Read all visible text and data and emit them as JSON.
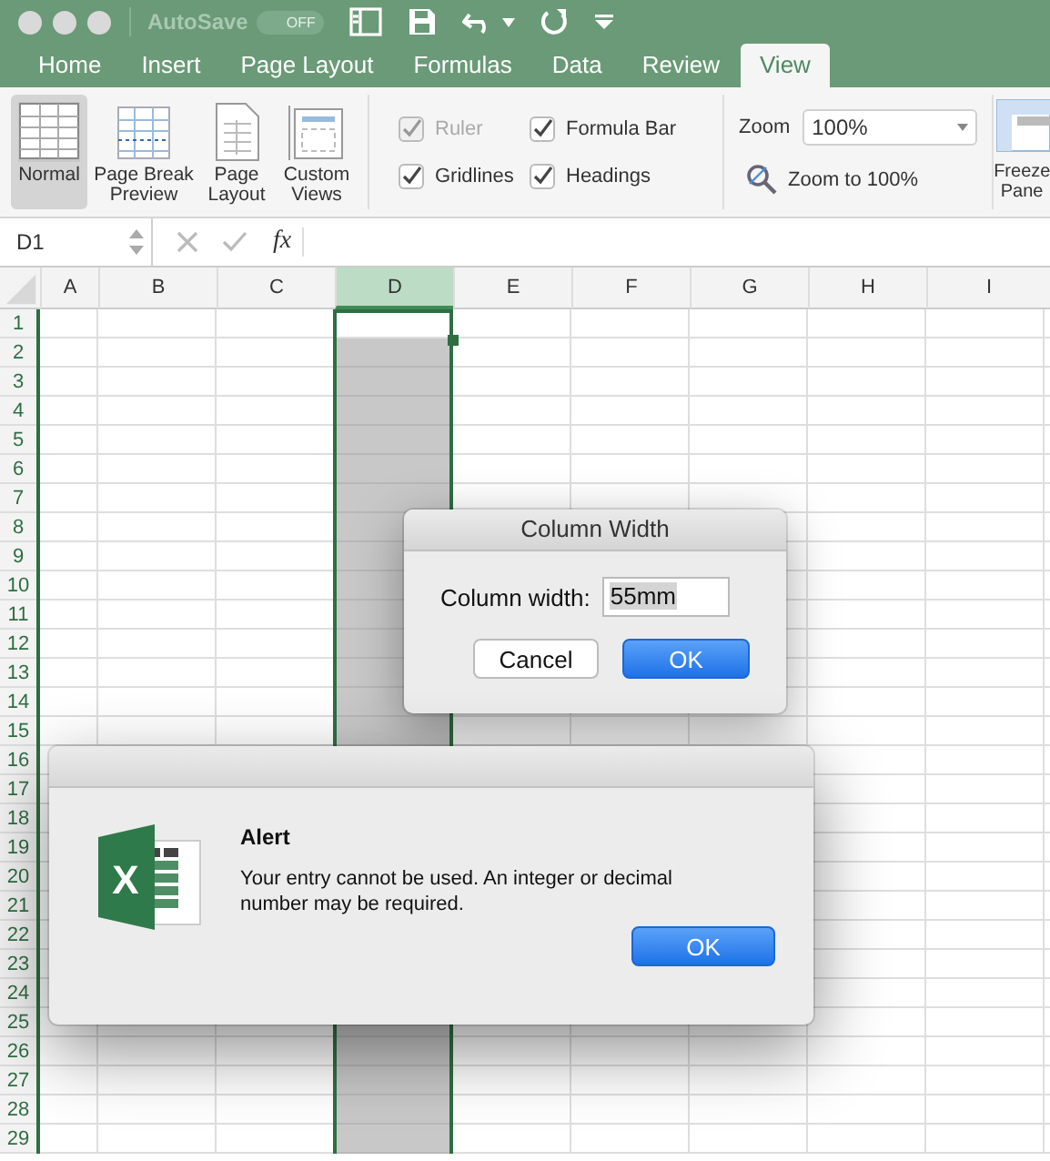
{
  "title_bar": {
    "autosave_label": "AutoSave",
    "autosave_toggle": {
      "label": "OFF",
      "on": false
    }
  },
  "tabs": [
    {
      "label": "Home",
      "selected": false
    },
    {
      "label": "Insert",
      "selected": false
    },
    {
      "label": "Page Layout",
      "selected": false
    },
    {
      "label": "Formulas",
      "selected": false
    },
    {
      "label": "Data",
      "selected": false
    },
    {
      "label": "Review",
      "selected": false
    },
    {
      "label": "View",
      "selected": true
    }
  ],
  "ribbon": {
    "views": [
      {
        "label": "Normal",
        "kind": "normal",
        "selected": true
      },
      {
        "label": "Page Break Preview",
        "kind": "pagebreak",
        "selected": false
      },
      {
        "label": "Page Layout",
        "kind": "pagelayout",
        "selected": false
      },
      {
        "label": "Custom Views",
        "kind": "custom",
        "selected": false
      }
    ],
    "show_options": [
      {
        "label": "Ruler",
        "checked": true,
        "disabled": true
      },
      {
        "label": "Formula Bar",
        "checked": true,
        "disabled": false
      },
      {
        "label": "Gridlines",
        "checked": true,
        "disabled": false
      },
      {
        "label": "Headings",
        "checked": true,
        "disabled": false
      }
    ],
    "zoom": {
      "label": "Zoom",
      "value": "100%",
      "zoom_to_label": "Zoom to 100%"
    },
    "freeze_panes": {
      "label": "Freeze Pane"
    }
  },
  "formula_bar": {
    "name_box": "D1",
    "function_label": "fx"
  },
  "sheet": {
    "columns": [
      {
        "label": "A",
        "selected": false
      },
      {
        "label": "B",
        "selected": false
      },
      {
        "label": "C",
        "selected": false
      },
      {
        "label": "D",
        "selected": true
      },
      {
        "label": "E",
        "selected": false
      },
      {
        "label": "F",
        "selected": false
      },
      {
        "label": "G",
        "selected": false
      },
      {
        "label": "H",
        "selected": false
      },
      {
        "label": "I",
        "selected": false
      }
    ],
    "rows": [
      "1",
      "2",
      "3",
      "4",
      "5",
      "6",
      "7",
      "8",
      "9",
      "10",
      "11",
      "12",
      "13",
      "14",
      "15",
      "16",
      "17",
      "18",
      "19",
      "20",
      "21",
      "22",
      "23",
      "24",
      "25",
      "26",
      "27",
      "28",
      "29"
    ]
  },
  "column_width_dialog": {
    "title": "Column Width",
    "field_label": "Column width:",
    "value": "55mm",
    "buttons": [
      {
        "label": "Cancel",
        "kind": "secondary"
      },
      {
        "label": "OK",
        "kind": "primary"
      }
    ]
  },
  "alert": {
    "logo_letter": "X",
    "title": "Alert",
    "message": "Your entry cannot be used. An integer or decimal number may be required.",
    "button": "OK"
  }
}
